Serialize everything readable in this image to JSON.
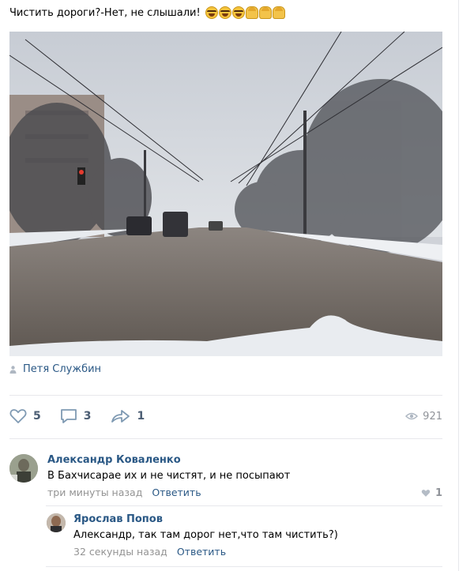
{
  "post": {
    "text": "Чистить дороги?-Нет, не слышали!",
    "emoji": [
      "laughing-face",
      "laughing-face",
      "laughing-face",
      "person",
      "person",
      "person"
    ],
    "author": "Петя Службин",
    "likes": "5",
    "comments": "3",
    "shares": "1",
    "views": "921"
  },
  "comments": [
    {
      "name": "Александр Коваленко",
      "text": "В Бахчисарае их и не чистят, и не посыпают",
      "time": "три минуты назад",
      "reply": "Ответить",
      "likes": "1"
    },
    {
      "name": "Ярослав Попов",
      "text": "Александр, так там дорог нет,что там чистить?)",
      "time": "32 секунды назад",
      "reply": "Ответить"
    }
  ],
  "colors": {
    "link": "#2a5885",
    "muted": "#939393",
    "action": "#4b5d73"
  }
}
